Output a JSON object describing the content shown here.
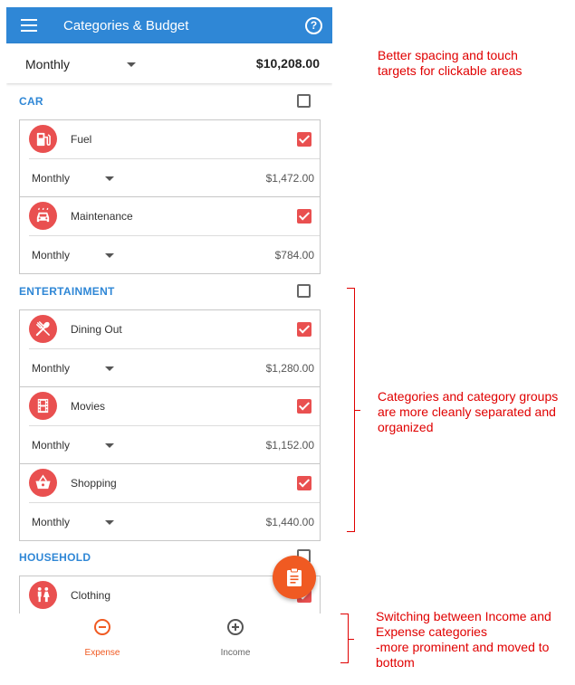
{
  "appbar": {
    "title": "Categories & Budget",
    "help_icon": "help-circle-icon",
    "menu_icon": "hamburger-menu-icon",
    "help_glyph": "?"
  },
  "summary": {
    "period": "Monthly",
    "total": "$10,208.00"
  },
  "groups": [
    {
      "title": "CAR",
      "items": [
        {
          "name": "Fuel",
          "period": "Monthly",
          "amount": "$1,472.00",
          "icon": "fuel-pump-icon"
        },
        {
          "name": "Maintenance",
          "period": "Monthly",
          "amount": "$784.00",
          "icon": "car-wash-icon"
        }
      ]
    },
    {
      "title": "ENTERTAINMENT",
      "items": [
        {
          "name": "Dining Out",
          "period": "Monthly",
          "amount": "$1,280.00",
          "icon": "utensils-icon"
        },
        {
          "name": "Movies",
          "period": "Monthly",
          "amount": "$1,152.00",
          "icon": "film-icon"
        },
        {
          "name": "Shopping",
          "period": "Monthly",
          "amount": "$1,440.00",
          "icon": "shopping-basket-icon"
        }
      ]
    },
    {
      "title": "HOUSEHOLD",
      "items": [
        {
          "name": "Clothing",
          "icon": "people-icon"
        }
      ]
    }
  ],
  "fab": {
    "icon": "clipboard-icon"
  },
  "bottom_nav": {
    "expense": {
      "label": "Expense",
      "icon": "minus-circle-icon"
    },
    "income": {
      "label": "Income",
      "icon": "plus-circle-icon"
    }
  },
  "annotations": {
    "top": "Better spacing and touch targets for clickable areas",
    "middle": "Categories and category groups are more cleanly separated and organized",
    "bottom_1": "Switching between Income and Expense categories",
    "bottom_2": "-more prominent and moved to bottom"
  },
  "colors": {
    "primary": "#2f87d6",
    "category_red": "#e95050",
    "accent_orange": "#f05a22",
    "annotation_red": "#e00000"
  }
}
